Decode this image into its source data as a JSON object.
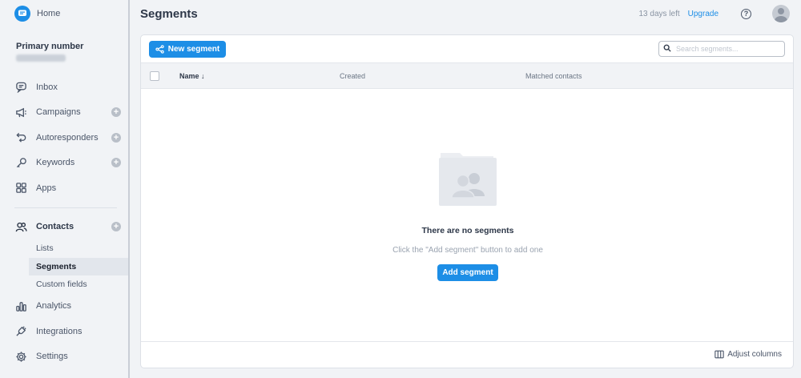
{
  "sidebar": {
    "home_label": "Home",
    "primary_title": "Primary number",
    "primary_number": "(●●●) ●●●-●●●●",
    "items": [
      {
        "label": "Inbox",
        "icon": "chat-bubble-icon",
        "plus": false
      },
      {
        "label": "Campaigns",
        "icon": "megaphone-icon",
        "plus": true
      },
      {
        "label": "Autoresponders",
        "icon": "reply-icon",
        "plus": true
      },
      {
        "label": "Keywords",
        "icon": "key-icon",
        "plus": true
      },
      {
        "label": "Apps",
        "icon": "grid-icon",
        "plus": false
      },
      {
        "label": "Contacts",
        "icon": "contacts-icon",
        "plus": true
      },
      {
        "label": "Analytics",
        "icon": "bar-chart-icon",
        "plus": false
      },
      {
        "label": "Integrations",
        "icon": "plug-icon",
        "plus": false
      },
      {
        "label": "Settings",
        "icon": "gear-icon",
        "plus": false
      }
    ],
    "contacts_sub": [
      "Lists",
      "Segments",
      "Custom fields"
    ],
    "active_sub": "Segments"
  },
  "header": {
    "title": "Segments",
    "trial_text": "13 days left",
    "upgrade_label": "Upgrade",
    "help_glyph": "?"
  },
  "toolbar": {
    "new_segment_label": "New segment",
    "search_placeholder": "Search segments..."
  },
  "table": {
    "columns": [
      "Name ↓",
      "Created",
      "Matched contacts"
    ]
  },
  "empty_state": {
    "title": "There are no segments",
    "subtitle": "Click the \"Add segment\" button to add one",
    "button_label": "Add segment"
  },
  "footer": {
    "adjust_label": "Adjust columns"
  },
  "colors": {
    "accent": "#1d8ee6",
    "sidebar_bg": "#f1f3f6",
    "text": "#2d3748"
  }
}
